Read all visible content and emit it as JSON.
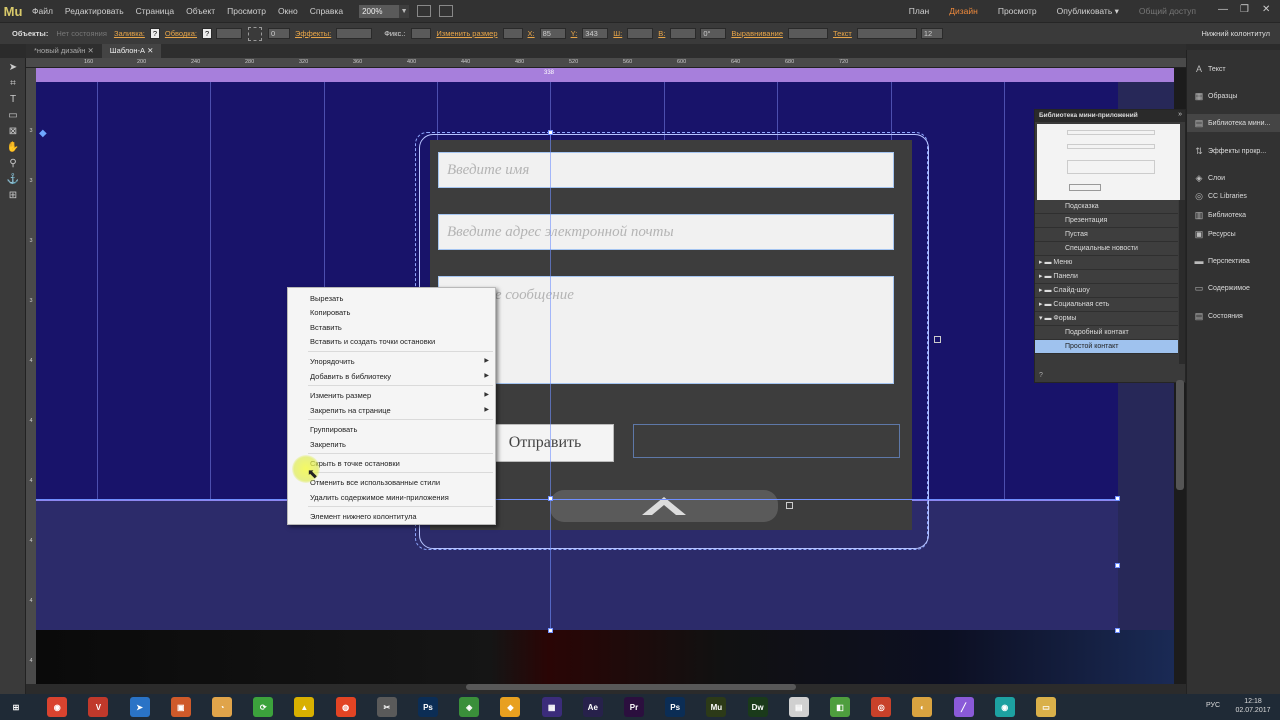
{
  "app": {
    "logo": "Mu"
  },
  "menu": [
    "Файл",
    "Редактировать",
    "Страница",
    "Объект",
    "Просмотр",
    "Окно",
    "Справка"
  ],
  "zoom": "200%",
  "modes": {
    "plan": "План",
    "design": "Дизайн",
    "preview": "Просмотр",
    "publish": "Опубликовать ▾",
    "shared": "Общий доступ"
  },
  "window_controls": {
    "minimize": "—",
    "restore": "❐",
    "close": "✕"
  },
  "controlbar": {
    "objects_label": "Объекты:",
    "state_label": "Нет состояния",
    "fill_label": "Заливка:",
    "stroke_label": "Обводка:",
    "stroke_value": "0",
    "effects_label": "Эффекты:",
    "fixed_label": "Фикс.:",
    "resize_label": "Изменить размер",
    "x_label": "X:",
    "x_value": "85",
    "y_label": "Y:",
    "y_value": "343",
    "w_label": "Ш:",
    "h_label": "В:",
    "rotation_value": "0°",
    "align_label": "Выравнивание",
    "text_label": "Текст",
    "font_size": "12",
    "footer_tag": "Нижний колонтитул"
  },
  "doc_tabs": [
    {
      "label": "*новый дизайн",
      "close": "✕"
    },
    {
      "label": "Шаблон-А",
      "close": "✕"
    }
  ],
  "ruler": {
    "h": [
      "160",
      "180",
      "200",
      "220",
      "240",
      "260",
      "280",
      "300",
      "320",
      "340",
      "360",
      "380",
      "400",
      "420",
      "440",
      "460",
      "480",
      "500",
      "520",
      "540",
      "560",
      "580",
      "600",
      "620",
      "640",
      "660",
      "680",
      "700",
      "720"
    ],
    "v": [
      "3",
      "3",
      "3",
      "3",
      "4",
      "4",
      "4",
      "4",
      "4",
      "4"
    ],
    "header_label": "338"
  },
  "form": {
    "name_placeholder": "Введите имя",
    "email_placeholder": "Введите адрес электронной почты",
    "message_placeholder": "Введите сообщение",
    "send_label": "Отправить"
  },
  "context_menu": {
    "items": [
      "Вырезать",
      "Копировать",
      "Вставить",
      "Вставить и создать точки остановки",
      "Упорядочить",
      "Добавить в библиотеку",
      "Изменить размер",
      "Закрепить на странице",
      "Группировать",
      "Закрепить",
      "Скрыть в точке остановки",
      "Отменить все использованные стили",
      "Удалить содержимое мини-приложения",
      "Элемент нижнего колонтитула"
    ]
  },
  "library": {
    "title": "Библиотека мини-приложений",
    "items": [
      "Подсказка",
      "Презентация",
      "Пустая",
      "Специальные новости"
    ],
    "folders": [
      "Меню",
      "Панели",
      "Слайд-шоу",
      "Социальная сеть",
      "Формы"
    ],
    "form_items": [
      "Подробный контакт",
      "Простой контакт"
    ],
    "help": "?"
  },
  "right_panel": [
    "Текст",
    "Образцы",
    "Библиотека мини...",
    "Эффекты прокр...",
    "Слои",
    "CC Libraries",
    "Библиотека",
    "Ресурсы",
    "Перспектива",
    "Содержимое",
    "Состояния"
  ],
  "taskbar": {
    "lang": "РУС",
    "time": "12:18",
    "date": "02.07.2017",
    "apps": [
      {
        "label": "⊞",
        "color": "#1f2a36"
      },
      {
        "label": "◉",
        "color": "#d9432f"
      },
      {
        "label": "V",
        "color": "#c0392b"
      },
      {
        "label": "➤",
        "color": "#2a73c6"
      },
      {
        "label": "▣",
        "color": "#cf5a2a"
      },
      {
        "label": "◔",
        "color": "#e0a44a"
      },
      {
        "label": "⟳",
        "color": "#3ca23c"
      },
      {
        "label": "▲",
        "color": "#d8b000"
      },
      {
        "label": "◍",
        "color": "#e24424"
      },
      {
        "label": "✂",
        "color": "#5a5a5a"
      },
      {
        "label": "Ps",
        "color": "#0b2d55"
      },
      {
        "label": "◈",
        "color": "#3a8f3a"
      },
      {
        "label": "◆",
        "color": "#e8a020"
      },
      {
        "label": "▦",
        "color": "#3b2c7a"
      },
      {
        "label": "Ae",
        "color": "#27214b"
      },
      {
        "label": "Pr",
        "color": "#2b0f3e"
      },
      {
        "label": "Ps",
        "color": "#0b2d55"
      },
      {
        "label": "Mu",
        "color": "#2c3a18"
      },
      {
        "label": "Dw",
        "color": "#1a3a1a"
      },
      {
        "label": "▤",
        "color": "#d0d0d0"
      },
      {
        "label": "◧",
        "color": "#4e9e3e"
      },
      {
        "label": "◎",
        "color": "#c8412a"
      },
      {
        "label": "◐",
        "color": "#d9a340"
      },
      {
        "label": "╱",
        "color": "#8a5ad8"
      },
      {
        "label": "◉",
        "color": "#1da1a1"
      },
      {
        "label": "▭",
        "color": "#d9b04a"
      }
    ]
  }
}
